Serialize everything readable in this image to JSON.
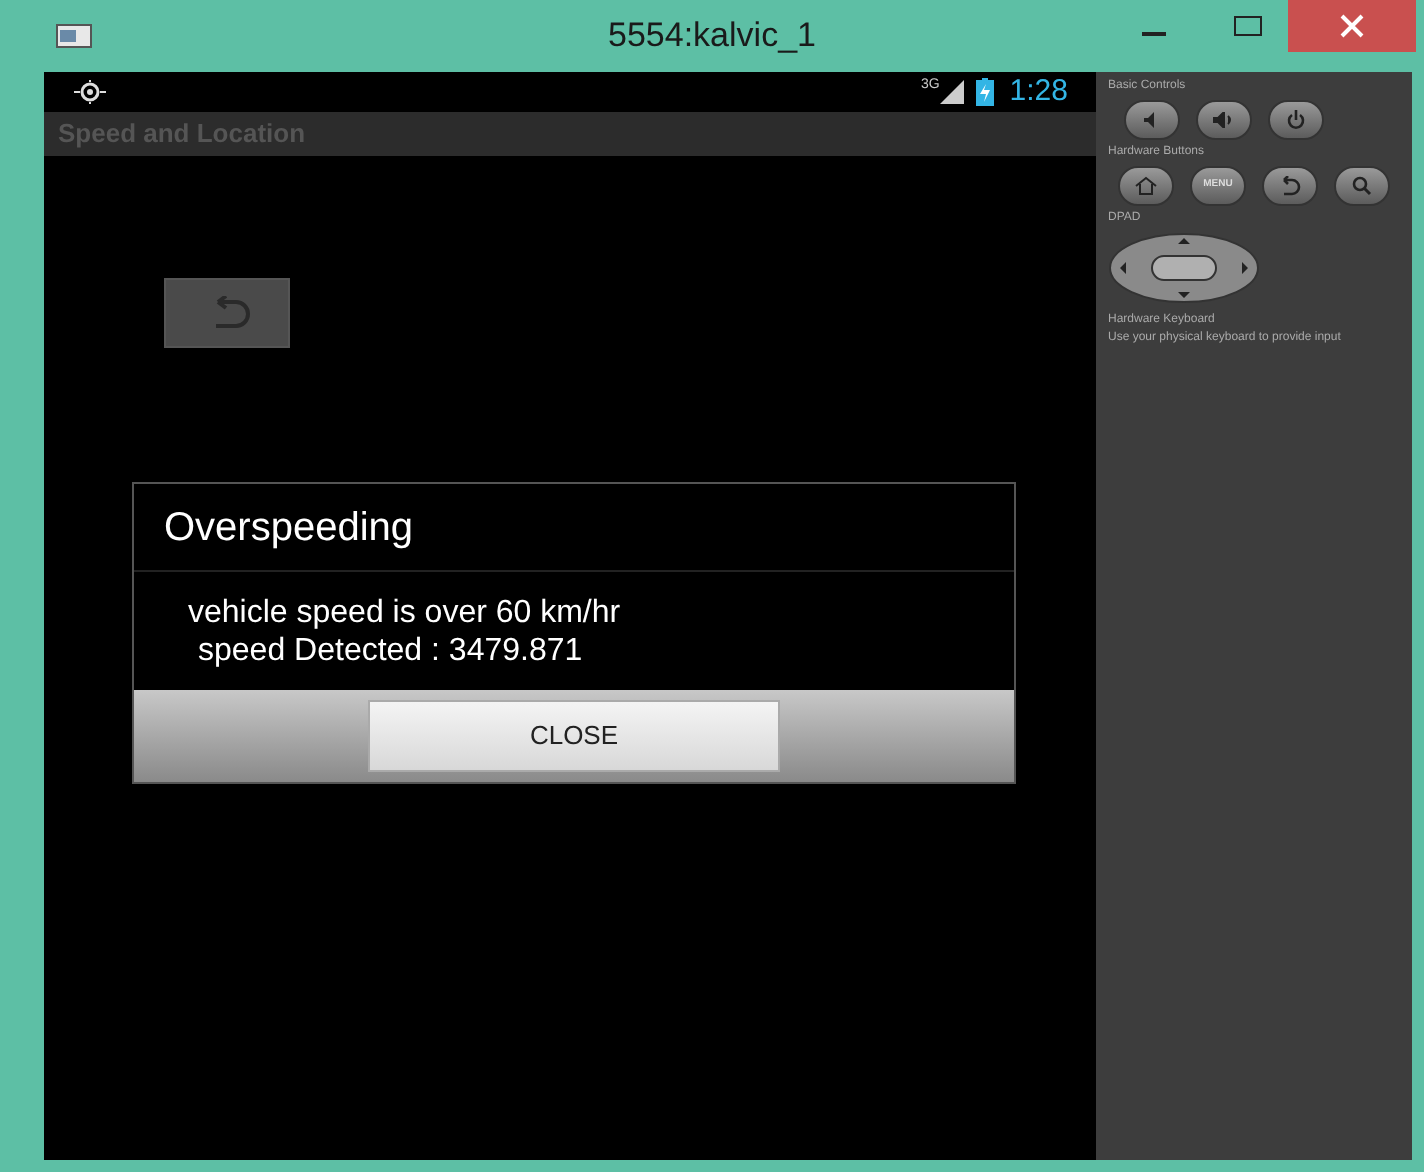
{
  "window": {
    "title": "5554:kalvic_1"
  },
  "status_bar": {
    "network": "3G",
    "time": "1:28"
  },
  "action_bar": {
    "title": "Speed and Location"
  },
  "dialog": {
    "title": "Overspeeding",
    "message_lines": [
      "vehicle speed is over 60 km/hr",
      "speed Detected : 3479.871"
    ],
    "button": "CLOSE"
  },
  "controls_panel": {
    "basic_controls": "Basic Controls",
    "hardware_buttons": "Hardware Buttons",
    "menu_button": "MENU",
    "dpad": "DPAD",
    "keyboard_title": "Hardware Keyboard",
    "keyboard_hint": "Use your physical keyboard to provide input"
  }
}
